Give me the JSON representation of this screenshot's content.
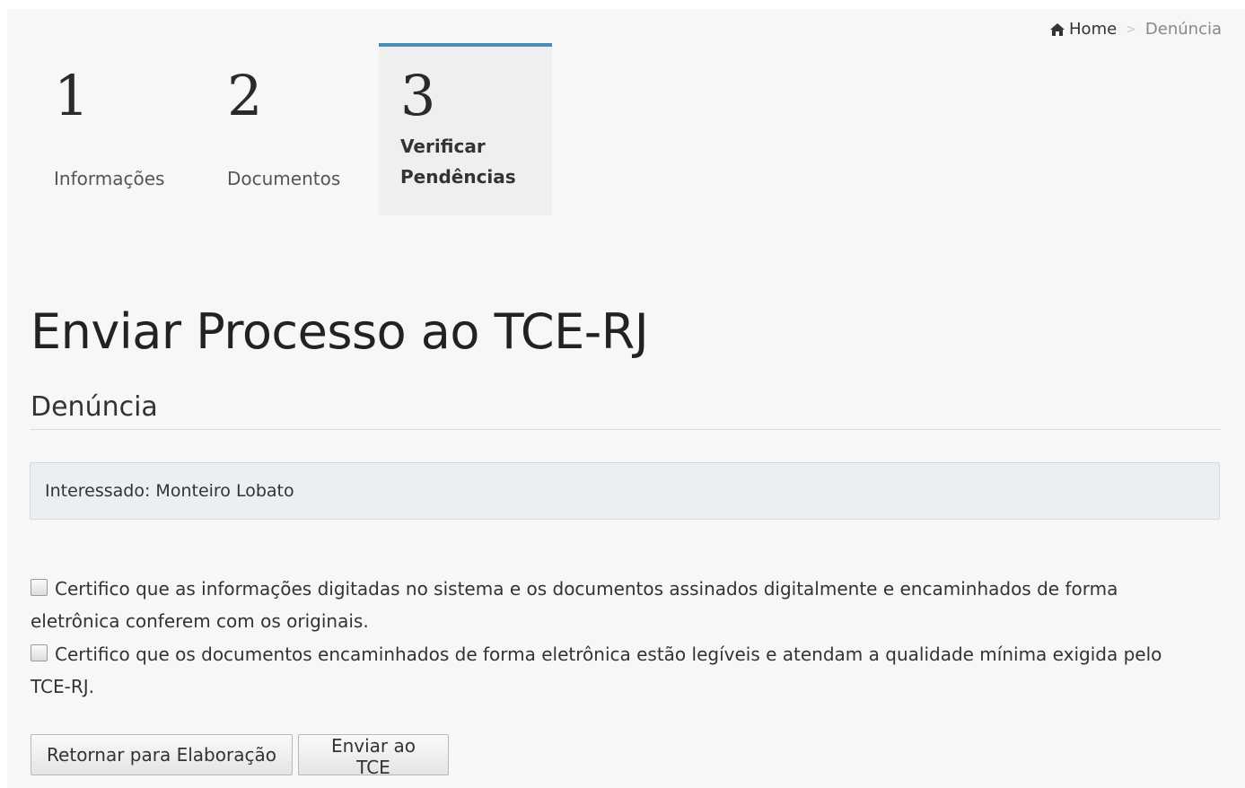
{
  "breadcrumb": {
    "home_label": "Home",
    "separator": ">",
    "current": "Denúncia"
  },
  "steps": [
    {
      "number": "1",
      "label": "Informações",
      "active": false
    },
    {
      "number": "2",
      "label": "Documentos",
      "active": false
    },
    {
      "number": "3",
      "label": "Verificar\nPendências",
      "active": true
    }
  ],
  "page": {
    "title": "Enviar Processo ao TCE-RJ",
    "subtitle": "Denúncia"
  },
  "info": {
    "interessado": "Interessado: Monteiro Lobato"
  },
  "certifications": [
    {
      "checked": false,
      "text": "Certifico que as informações digitadas no sistema e os documentos assinados digitalmente e encaminhados de forma eletrônica conferem com os originais."
    },
    {
      "checked": false,
      "text": "Certifico que os documentos encaminhados de forma eletrônica estão legíveis e atendam a qualidade mínima exigida pelo TCE-RJ."
    }
  ],
  "actions": {
    "return_label": "Retornar para Elaboração",
    "send_label": "Enviar ao TCE"
  },
  "colors": {
    "active_step_border": "#4f8cb3",
    "background": "#f7f7f7"
  },
  "icons": {
    "home": "home-icon"
  }
}
